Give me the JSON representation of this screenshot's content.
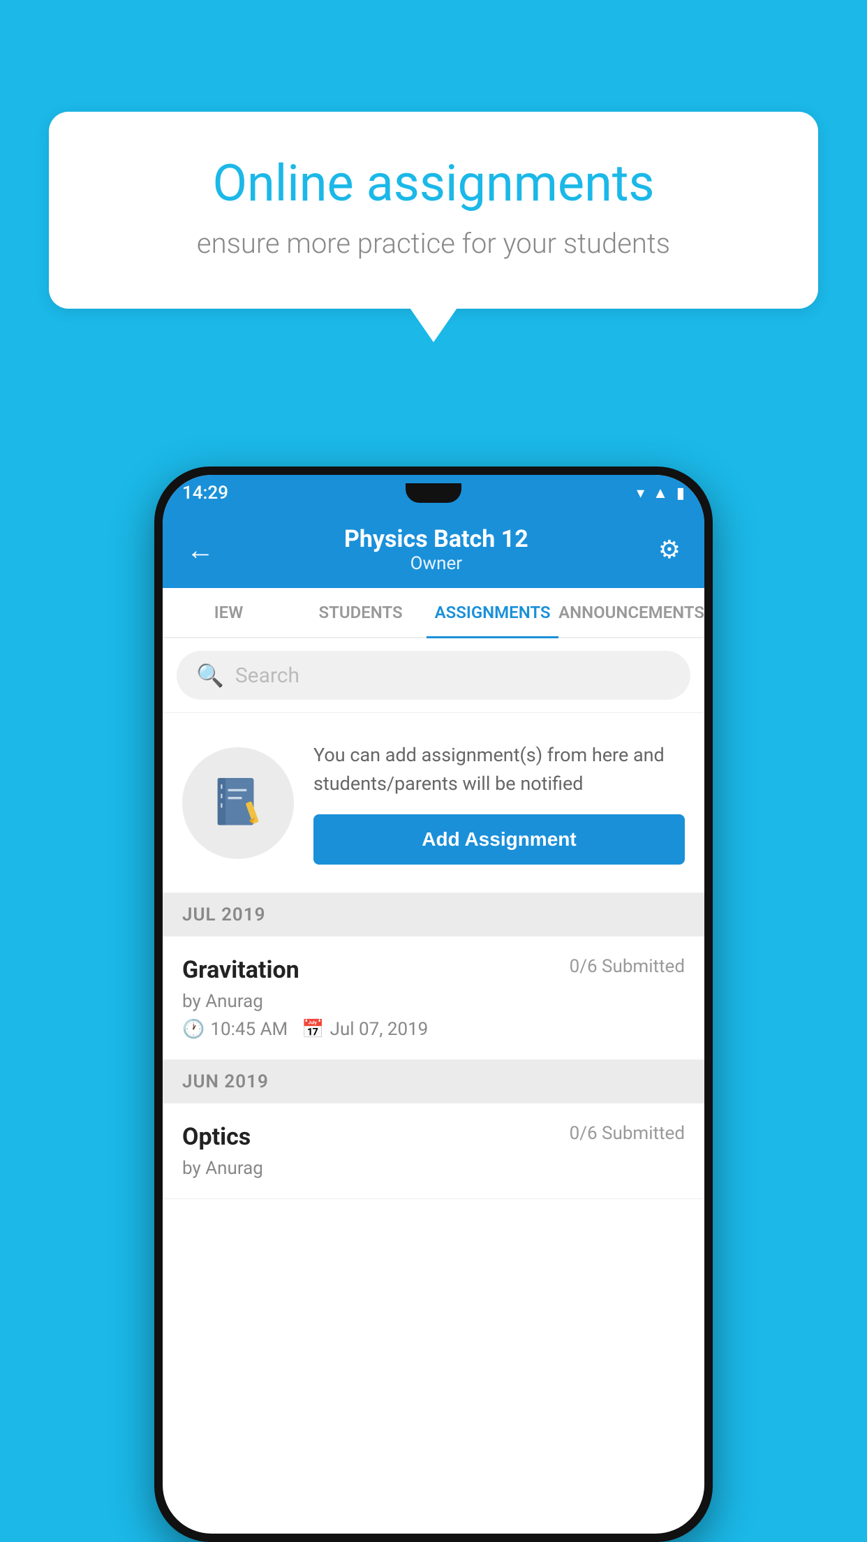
{
  "background_color": "#1bb8e8",
  "speech_bubble": {
    "title": "Online assignments",
    "subtitle": "ensure more practice for your students"
  },
  "status_bar": {
    "time": "14:29",
    "icons": [
      "wifi",
      "signal",
      "battery"
    ]
  },
  "app_bar": {
    "title": "Physics Batch 12",
    "subtitle": "Owner",
    "back_label": "←",
    "settings_label": "⚙"
  },
  "tabs": [
    {
      "label": "IEW",
      "active": false
    },
    {
      "label": "STUDENTS",
      "active": false
    },
    {
      "label": "ASSIGNMENTS",
      "active": true
    },
    {
      "label": "ANNOUNCEMENTS",
      "active": false
    }
  ],
  "search": {
    "placeholder": "Search"
  },
  "add_assignment": {
    "description": "You can add assignment(s) from here and students/parents will be notified",
    "button_label": "Add Assignment"
  },
  "sections": [
    {
      "month": "JUL 2019",
      "assignments": [
        {
          "name": "Gravitation",
          "submitted": "0/6 Submitted",
          "author": "by Anurag",
          "time": "10:45 AM",
          "date": "Jul 07, 2019"
        }
      ]
    },
    {
      "month": "JUN 2019",
      "assignments": [
        {
          "name": "Optics",
          "submitted": "0/6 Submitted",
          "author": "by Anurag",
          "time": "",
          "date": ""
        }
      ]
    }
  ]
}
